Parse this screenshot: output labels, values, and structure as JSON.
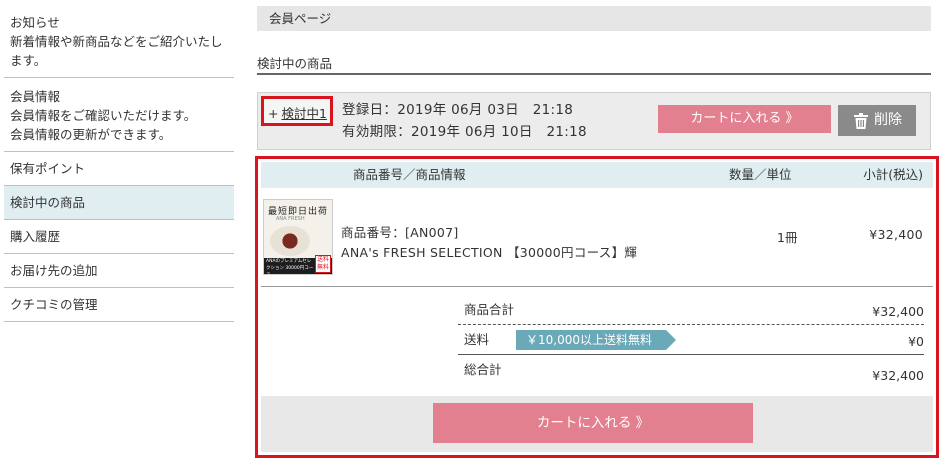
{
  "sidebar": {
    "items": [
      {
        "title": "お知らせ",
        "desc": "新着情報や新商品などをご紹介いたします。"
      },
      {
        "title": "会員情報",
        "desc": "会員情報をご確認いただけます。\n会員情報の更新ができます。"
      },
      {
        "title": "保有ポイント"
      },
      {
        "title": "検討中の商品"
      },
      {
        "title": "購入履歴"
      },
      {
        "title": "お届け先の追加"
      },
      {
        "title": "クチコミの管理"
      }
    ]
  },
  "main": {
    "page_header": "会員ページ",
    "section_title": "検討中の商品",
    "wish": {
      "toggle_plus": "+",
      "toggle_label": "検討中1",
      "registered": "登録日：2019年 06月 03日　21:18",
      "expires": "有効期限：2019年 06月 10日　21:18",
      "cart_button": "カートに入れる 》",
      "delete_button": "削除"
    },
    "table": {
      "headers": {
        "product": "商品番号／商品情報",
        "qty": "数量／単位",
        "subtotal": "小計(税込)"
      },
      "item": {
        "image_text_top": "最短即日出荷",
        "image_text_sub": "ANA FRESH",
        "image_band_text": "ANAのプレミアムセレクション 30000円コース",
        "image_stamp": "送料無料",
        "code": "商品番号：[AN007]",
        "name": "ANA's FRESH SELECTION 【30000円コース】輝",
        "qty": "1冊",
        "subtotal": "¥32,400"
      }
    },
    "totals": {
      "goods_label": "商品合計",
      "goods_value": "¥32,400",
      "shipping_label": "送料",
      "shipping_badge": "￥10,000以上送料無料",
      "shipping_value": "¥0",
      "grand_label": "総合計",
      "grand_value": "¥32,400"
    },
    "cart_button_big": "カートに入れる 》"
  },
  "colors": {
    "highlight_border": "#d8141f",
    "cart_button": "#e38090",
    "delete_button": "#8a8a8a",
    "table_header": "#e0eef2",
    "free_shipping_badge": "#6aa9b8"
  }
}
